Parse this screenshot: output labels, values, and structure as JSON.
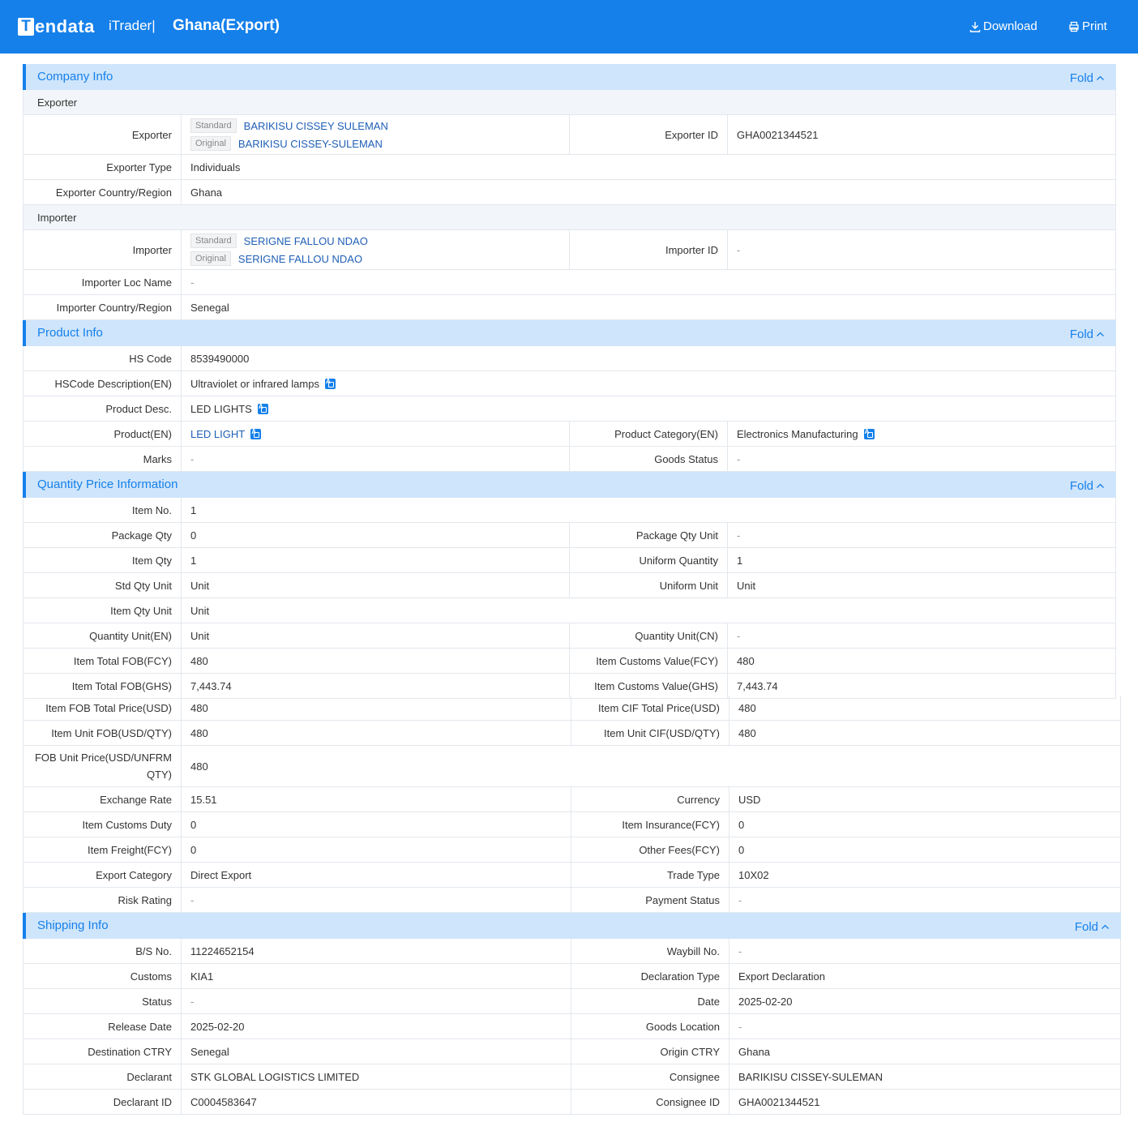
{
  "header": {
    "brand": "Tendata",
    "brand_mark": "T",
    "brand_rest": "endata",
    "product": "iTrader|",
    "title": "Ghana(Export)",
    "download": "Download",
    "print": "Print"
  },
  "fold_label": "Fold",
  "tags": {
    "standard": "Standard",
    "original": "Original"
  },
  "company": {
    "title": "Company Info",
    "exporter_group": "Exporter",
    "importer_group": "Importer",
    "exporter_label": "Exporter",
    "exporter_standard": "BARIKISU CISSEY SULEMAN",
    "exporter_original": "BARIKISU CISSEY-SULEMAN",
    "exporter_id_label": "Exporter ID",
    "exporter_id": "GHA0021344521",
    "exporter_type_label": "Exporter Type",
    "exporter_type": "Individuals",
    "exporter_country_label": "Exporter Country/Region",
    "exporter_country": "Ghana",
    "importer_label": "Importer",
    "importer_standard": "SERIGNE FALLOU NDAO",
    "importer_original": "SERIGNE FALLOU NDAO",
    "importer_id_label": "Importer ID",
    "importer_id": "-",
    "importer_loc_label": "Importer  Loc Name",
    "importer_loc": "-",
    "importer_country_label": "Importer Country/Region",
    "importer_country": "Senegal"
  },
  "product": {
    "title": "Product Info",
    "hs_code_label": "HS Code",
    "hs_code": "8539490000",
    "hs_desc_label": "HSCode Description(EN)",
    "hs_desc": "Ultraviolet or infrared lamps",
    "desc_label": "Product Desc.",
    "desc": "LED LIGHTS",
    "product_en_label": "Product(EN)",
    "product_en": "LED LIGHT",
    "category_label": "Product Category(EN)",
    "category": "Electronics Manufacturing",
    "marks_label": "Marks",
    "marks": "-",
    "goods_status_label": "Goods Status",
    "goods_status": "-"
  },
  "quantity": {
    "title": "Quantity Price Information",
    "rows": [
      {
        "l1": "Item No.",
        "v1": "1"
      },
      {
        "l1": "Package Qty",
        "v1": "0",
        "l2": "Package Qty Unit",
        "v2": "-"
      },
      {
        "l1": "Item Qty",
        "v1": "1",
        "l2": "Uniform Quantity",
        "v2": "1"
      },
      {
        "l1": "Std Qty Unit",
        "v1": "Unit",
        "l2": "Uniform Unit",
        "v2": "Unit"
      },
      {
        "l1": "Item Qty Unit",
        "v1": "Unit"
      },
      {
        "l1": "Quantity Unit(EN)",
        "v1": "Unit",
        "l2": "Quantity Unit(CN)",
        "v2": "-"
      },
      {
        "l1": "Item Total FOB(FCY)",
        "v1": "480",
        "l2": "Item Customs Value(FCY)",
        "v2": "480"
      },
      {
        "l1": "Item Total FOB(GHS)",
        "v1": "7,443.74",
        "l2": "Item Customs Value(GHS)",
        "v2": "7,443.74"
      }
    ],
    "rows_b": [
      {
        "l1": "Item FOB Total Price(USD)",
        "v1": "480",
        "l2": "Item CIF Total Price(USD)",
        "v2": "480"
      },
      {
        "l1": "Item Unit FOB(USD/QTY)",
        "v1": "480",
        "l2": "Item Unit CIF(USD/QTY)",
        "v2": "480"
      },
      {
        "l1": "FOB Unit Price(USD/UNFRM QTY)",
        "v1": "480"
      },
      {
        "l1": "Exchange Rate",
        "v1": "15.51",
        "l2": "Currency",
        "v2": "USD"
      },
      {
        "l1": "Item Customs Duty",
        "v1": "0",
        "l2": "Item Insurance(FCY)",
        "v2": "0"
      },
      {
        "l1": "Item Freight(FCY)",
        "v1": "0",
        "l2": "Other Fees(FCY)",
        "v2": "0"
      },
      {
        "l1": "Export Category",
        "v1": "Direct Export",
        "l2": "Trade Type",
        "v2": "10X02"
      },
      {
        "l1": "Risk Rating",
        "v1": "-",
        "l2": "Payment Status",
        "v2": "-"
      }
    ]
  },
  "shipping": {
    "title": "Shipping Info",
    "rows": [
      {
        "l1": "B/S No.",
        "v1": "11224652154",
        "l2": "Waybill No.",
        "v2": "-"
      },
      {
        "l1": "Customs",
        "v1": "KIA1",
        "l2": "Declaration Type",
        "v2": "Export Declaration"
      },
      {
        "l1": "Status",
        "v1": "-",
        "l2": "Date",
        "v2": "2025-02-20"
      },
      {
        "l1": "Release Date",
        "v1": "2025-02-20",
        "l2": "Goods Location",
        "v2": "-"
      },
      {
        "l1": "Destination CTRY",
        "v1": "Senegal",
        "l2": "Origin CTRY",
        "v2": "Ghana"
      },
      {
        "l1": "Declarant",
        "v1": "STK GLOBAL LOGISTICS LIMITED",
        "l2": "Consignee",
        "v2": "BARIKISU CISSEY-SULEMAN"
      },
      {
        "l1": "Declarant ID",
        "v1": "C0004583647",
        "l2": "Consignee ID",
        "v2": "GHA0021344521"
      }
    ]
  },
  "colors": {
    "primary": "#1580ea",
    "section_bg": "#cfe5fb",
    "link": "#1f5fb6"
  },
  "icons": {
    "download": "download-icon",
    "print": "printer-icon",
    "fold": "chevron-up-icon",
    "translate": "translate-icon"
  }
}
